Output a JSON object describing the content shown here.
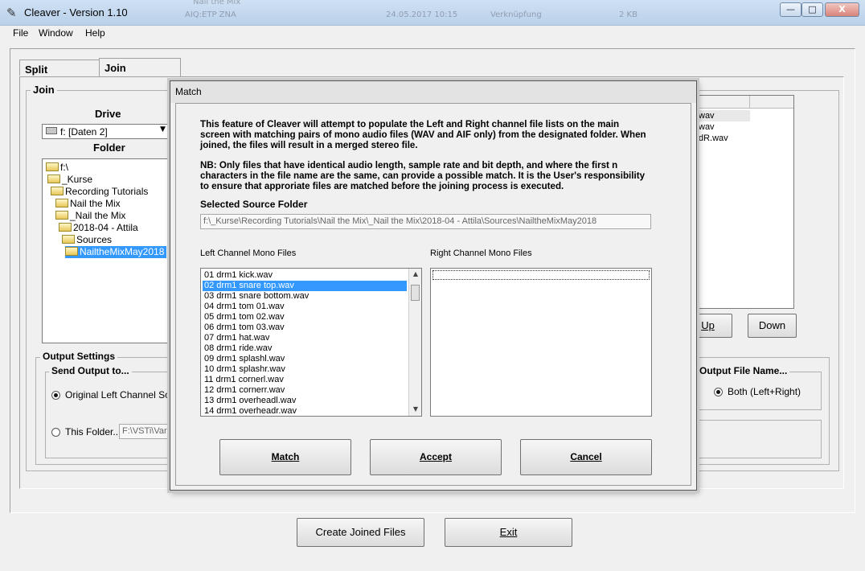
{
  "window": {
    "title": "Cleaver - Version 1.10",
    "minimize": "—",
    "maximize": "□",
    "close": "X",
    "background_ghost": [
      "Nail the Mix",
      "AIQ:ETP ZNA",
      "24.05.2017 10:15",
      "Verknüpfung",
      "2 KB"
    ]
  },
  "menu": [
    "File",
    "Window",
    "Help"
  ],
  "tabs": {
    "split": "Split",
    "join": "Join"
  },
  "join_group": {
    "title": "Join",
    "drive_label": "Drive",
    "drive_value": "f: [Daten 2]",
    "folder_label": "Folder",
    "folders": [
      "f:\\",
      "_Kurse",
      "Recording Tutorials",
      "Nail the Mix",
      "_Nail the Mix",
      "2018-04 - Attila",
      "Sources",
      "NailtheMixMay2018"
    ],
    "selected_folder_index": 7,
    "right_list": [
      "wav",
      "wav",
      "dR.wav"
    ],
    "up_label": "Up",
    "down_label": "Down"
  },
  "output_settings": {
    "title": "Output Settings",
    "send_output_title": "Send Output to...",
    "original_label": "Original Left Channel Source",
    "this_folder_label": "This Folder...",
    "this_folder_value": "F:\\VSTi\\Variou",
    "file_name_title": "Output File Name...",
    "both_label": "Both (Left+Right)"
  },
  "bottom": {
    "create_label": "Create Joined Files",
    "exit_label": "Exit"
  },
  "dialog": {
    "title": "Match",
    "intro": "This feature of Cleaver will attempt to populate the Left and Right channel file lists on the main screen with matching pairs of mono audio files (WAV and AIF only) from the designated folder. When joined, the files will result in a merged stereo file.",
    "note": "NB: Only files that have identical audio length, sample rate and bit depth, and where the first n characters in the file name are the same, can provide a possible match.  It is the User's responsibility to ensure that approriate files are matched before the joining process is executed.",
    "source_label": "Selected Source Folder",
    "source_value": "f:\\_Kurse\\Recording Tutorials\\Nail the Mix\\_Nail the Mix\\2018-04 - Attila\\Sources\\NailtheMixMay2018",
    "left_label": "Left Channel Mono Files",
    "right_label": "Right Channel Mono Files",
    "left_files": [
      "01 drm1 kick.wav",
      "02 drm1 snare top.wav",
      "03 drm1 snare bottom.wav",
      "04 drm1 tom 01.wav",
      "05 drm1 tom 02.wav",
      "06 drm1 tom 03.wav",
      "07 drm1 hat.wav",
      "08 drm1 ride.wav",
      "09 drm1 splashl.wav",
      "10 drm1 splashr.wav",
      "11 drm1 cornerl.wav",
      "12 drm1 cornerr.wav",
      "13 drm1 overheadl.wav",
      "14 drm1 overheadr.wav"
    ],
    "selected_left_index": 1,
    "match_label": "Match",
    "accept_label": "Accept",
    "cancel_label": "Cancel"
  }
}
